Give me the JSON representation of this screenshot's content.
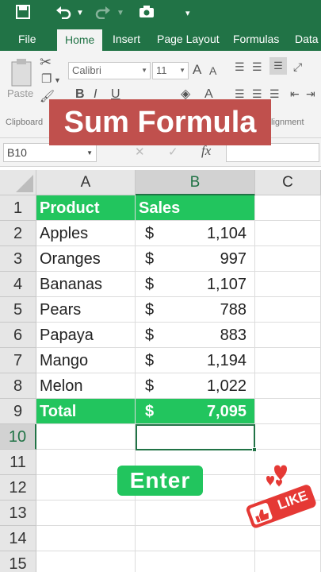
{
  "qat": {
    "icons": [
      "save-icon",
      "undo-icon",
      "redo-icon",
      "camera-icon",
      "customize-icon"
    ]
  },
  "ribbon_tabs": [
    "File",
    "Home",
    "Insert",
    "Page Layout",
    "Formulas",
    "Data"
  ],
  "active_tab": "Home",
  "ribbon": {
    "paste_label": "Paste",
    "font_name": "Calibri",
    "font_size": "11",
    "grow_label": "A",
    "shrink_label": "A",
    "bold": "B",
    "italic": "I",
    "underline": "U",
    "font_color_label": "A",
    "clipboard_label": "Clipboard",
    "alignment_label": "lignment"
  },
  "formula_bar": {
    "name_box": "B10",
    "cancel": "✕",
    "confirm": "✓",
    "fx": "fx",
    "value": ""
  },
  "overlay_title": "Sum Formula",
  "columns": [
    "A",
    "B",
    "C"
  ],
  "rows": [
    "1",
    "2",
    "3",
    "4",
    "5",
    "6",
    "7",
    "8",
    "9",
    "10",
    "11",
    "12",
    "13",
    "14",
    "15"
  ],
  "table": {
    "header": {
      "product": "Product",
      "sales": "Sales"
    },
    "items": [
      {
        "product": "Apples",
        "currency": "$",
        "amount": "1,104"
      },
      {
        "product": "Oranges",
        "currency": "$",
        "amount": "997"
      },
      {
        "product": "Bananas",
        "currency": "$",
        "amount": "1,107"
      },
      {
        "product": "Pears",
        "currency": "$",
        "amount": "788"
      },
      {
        "product": "Papaya",
        "currency": "$",
        "amount": "883"
      },
      {
        "product": "Mango",
        "currency": "$",
        "amount": "1,194"
      },
      {
        "product": "Melon",
        "currency": "$",
        "amount": "1,022"
      }
    ],
    "total": {
      "label": "Total",
      "currency": "$",
      "amount": "7,095"
    }
  },
  "selected_cell": "B10",
  "enter_badge": "Enter",
  "like_badge": "LIKE",
  "colors": {
    "excel_green": "#217346",
    "highlight_green": "#22c55e",
    "title_red": "#c0504d",
    "like_red": "#e53935"
  }
}
